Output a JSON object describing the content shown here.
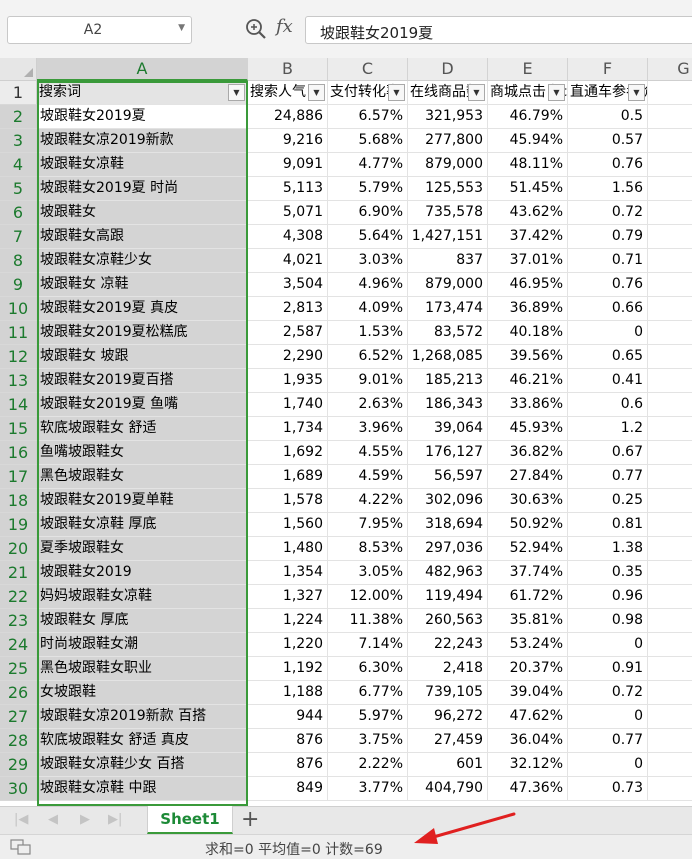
{
  "name_box": "A2",
  "formula_value": "坡跟鞋女2019夏",
  "fx_label": "fx",
  "columns": [
    "A",
    "B",
    "C",
    "D",
    "E",
    "F",
    "G"
  ],
  "headers": [
    "搜索词",
    "搜索人气",
    "支付转化率",
    "在线商品数",
    "商城点击占比",
    "直通车参考价"
  ],
  "rows": [
    {
      "num": "2",
      "term": "坡跟鞋女2019夏",
      "pop": "24,886",
      "conv": "6.57%",
      "online": "321,953",
      "click": "46.79%",
      "ref": "0.5"
    },
    {
      "num": "3",
      "term": "坡跟鞋女凉2019新款",
      "pop": "9,216",
      "conv": "5.68%",
      "online": "277,800",
      "click": "45.94%",
      "ref": "0.57"
    },
    {
      "num": "4",
      "term": "坡跟鞋女凉鞋",
      "pop": "9,091",
      "conv": "4.77%",
      "online": "879,000",
      "click": "48.11%",
      "ref": "0.76"
    },
    {
      "num": "5",
      "term": "坡跟鞋女2019夏 时尚",
      "pop": "5,113",
      "conv": "5.79%",
      "online": "125,553",
      "click": "51.45%",
      "ref": "1.56"
    },
    {
      "num": "6",
      "term": "坡跟鞋女",
      "pop": "5,071",
      "conv": "6.90%",
      "online": "735,578",
      "click": "43.62%",
      "ref": "0.72"
    },
    {
      "num": "7",
      "term": "坡跟鞋女高跟",
      "pop": "4,308",
      "conv": "5.64%",
      "online": "1,427,151",
      "click": "37.42%",
      "ref": "0.79"
    },
    {
      "num": "8",
      "term": "坡跟鞋女凉鞋少女",
      "pop": "4,021",
      "conv": "3.03%",
      "online": "837",
      "click": "37.01%",
      "ref": "0.71"
    },
    {
      "num": "9",
      "term": "坡跟鞋女 凉鞋",
      "pop": "3,504",
      "conv": "4.96%",
      "online": "879,000",
      "click": "46.95%",
      "ref": "0.76"
    },
    {
      "num": "10",
      "term": "坡跟鞋女2019夏 真皮",
      "pop": "2,813",
      "conv": "4.09%",
      "online": "173,474",
      "click": "36.89%",
      "ref": "0.66"
    },
    {
      "num": "11",
      "term": "坡跟鞋女2019夏松糕底",
      "pop": "2,587",
      "conv": "1.53%",
      "online": "83,572",
      "click": "40.18%",
      "ref": "0"
    },
    {
      "num": "12",
      "term": "坡跟鞋女 坡跟",
      "pop": "2,290",
      "conv": "6.52%",
      "online": "1,268,085",
      "click": "39.56%",
      "ref": "0.65"
    },
    {
      "num": "13",
      "term": "坡跟鞋女2019夏百搭",
      "pop": "1,935",
      "conv": "9.01%",
      "online": "185,213",
      "click": "46.21%",
      "ref": "0.41"
    },
    {
      "num": "14",
      "term": "坡跟鞋女2019夏 鱼嘴",
      "pop": "1,740",
      "conv": "2.63%",
      "online": "186,343",
      "click": "33.86%",
      "ref": "0.6"
    },
    {
      "num": "15",
      "term": "软底坡跟鞋女 舒适",
      "pop": "1,734",
      "conv": "3.96%",
      "online": "39,064",
      "click": "45.93%",
      "ref": "1.2"
    },
    {
      "num": "16",
      "term": "鱼嘴坡跟鞋女",
      "pop": "1,692",
      "conv": "4.55%",
      "online": "176,127",
      "click": "36.82%",
      "ref": "0.67"
    },
    {
      "num": "17",
      "term": "黑色坡跟鞋女",
      "pop": "1,689",
      "conv": "4.59%",
      "online": "56,597",
      "click": "27.84%",
      "ref": "0.77"
    },
    {
      "num": "18",
      "term": "坡跟鞋女2019夏单鞋",
      "pop": "1,578",
      "conv": "4.22%",
      "online": "302,096",
      "click": "30.63%",
      "ref": "0.25"
    },
    {
      "num": "19",
      "term": "坡跟鞋女凉鞋 厚底",
      "pop": "1,560",
      "conv": "7.95%",
      "online": "318,694",
      "click": "50.92%",
      "ref": "0.81"
    },
    {
      "num": "20",
      "term": "夏季坡跟鞋女",
      "pop": "1,480",
      "conv": "8.53%",
      "online": "297,036",
      "click": "52.94%",
      "ref": "1.38"
    },
    {
      "num": "21",
      "term": "坡跟鞋女2019",
      "pop": "1,354",
      "conv": "3.05%",
      "online": "482,963",
      "click": "37.74%",
      "ref": "0.35"
    },
    {
      "num": "22",
      "term": "妈妈坡跟鞋女凉鞋",
      "pop": "1,327",
      "conv": "12.00%",
      "online": "119,494",
      "click": "61.72%",
      "ref": "0.96"
    },
    {
      "num": "23",
      "term": "坡跟鞋女 厚底",
      "pop": "1,224",
      "conv": "11.38%",
      "online": "260,563",
      "click": "35.81%",
      "ref": "0.98"
    },
    {
      "num": "24",
      "term": "时尚坡跟鞋女潮",
      "pop": "1,220",
      "conv": "7.14%",
      "online": "22,243",
      "click": "53.24%",
      "ref": "0"
    },
    {
      "num": "25",
      "term": "黑色坡跟鞋女职业",
      "pop": "1,192",
      "conv": "6.30%",
      "online": "2,418",
      "click": "20.37%",
      "ref": "0.91"
    },
    {
      "num": "26",
      "term": "女坡跟鞋",
      "pop": "1,188",
      "conv": "6.77%",
      "online": "739,105",
      "click": "39.04%",
      "ref": "0.72"
    },
    {
      "num": "27",
      "term": "坡跟鞋女凉2019新款 百搭",
      "pop": "944",
      "conv": "5.97%",
      "online": "96,272",
      "click": "47.62%",
      "ref": "0"
    },
    {
      "num": "28",
      "term": "软底坡跟鞋女 舒适 真皮",
      "pop": "876",
      "conv": "3.75%",
      "online": "27,459",
      "click": "36.04%",
      "ref": "0.77"
    },
    {
      "num": "29",
      "term": "坡跟鞋女凉鞋少女 百搭",
      "pop": "876",
      "conv": "2.22%",
      "online": "601",
      "click": "32.12%",
      "ref": "0"
    },
    {
      "num": "30",
      "term": "坡跟鞋女凉鞋 中跟",
      "pop": "849",
      "conv": "3.77%",
      "online": "404,790",
      "click": "47.36%",
      "ref": "0.73"
    }
  ],
  "sheet_tab": "Sheet1",
  "add_sheet": "+",
  "status": "求和=0  平均值=0  计数=69",
  "colors": {
    "accent": "#3a9a3a",
    "arrow": "#e02020"
  }
}
